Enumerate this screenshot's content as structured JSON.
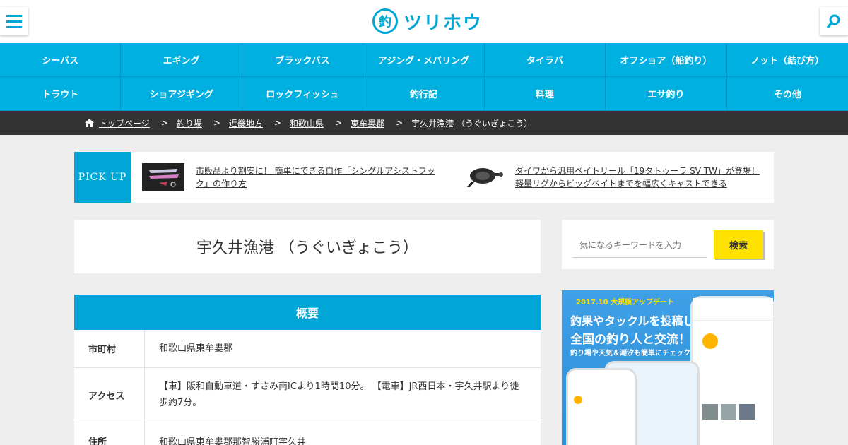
{
  "header": {
    "logo_mark": "釣",
    "logo_text": "ツリホウ"
  },
  "nav": {
    "items": [
      "シーバス",
      "エギング",
      "ブラックバス",
      "アジング・メバリング",
      "タイラバ",
      "オフショア（船釣り）",
      "ノット（結び方）",
      "トラウト",
      "ショアジギング",
      "ロックフィッシュ",
      "釣行記",
      "料理",
      "エサ釣り",
      "その他"
    ]
  },
  "breadcrumb": {
    "items": [
      "トップページ",
      "釣り場",
      "近畿地方",
      "和歌山県",
      "東牟婁郡"
    ],
    "current": "宇久井漁港 （うぐいぎょこう）",
    "separator": ">"
  },
  "pickup": {
    "label": "PICK UP",
    "items": [
      {
        "text": "市販品より割安に！ 簡単にできる自作「シングルアシストフック」の作り方"
      },
      {
        "text": "ダイワから汎用ベイトリール「19タトゥーラ SV TW」が登場！軽量リグからビッグベイトまでを幅広くキャストできる"
      }
    ]
  },
  "page": {
    "title": "宇久井漁港 （うぐいぎょこう）"
  },
  "overview": {
    "heading": "概要",
    "rows": [
      {
        "label": "市町村",
        "value": "和歌山県東牟婁郡"
      },
      {
        "label": "アクセス",
        "value": "【車】阪和自動車道・すさみ南ICより1時間10分。 【電車】JR西日本・宇久井駅より徒歩約7分。"
      },
      {
        "label": "住所",
        "value": "和歌山県東牟婁郡那智勝浦町宇久井"
      }
    ]
  },
  "sidebar": {
    "search_placeholder": "気になるキーワードを入力",
    "search_button": "検索",
    "banner": {
      "tag": "2017.10 大規模アップデート",
      "line1": "釣果やタックルを投稿して",
      "line2": "全国の釣り人と交流！",
      "line3": "釣り場や天気＆潮汐も簡単にチェック"
    }
  },
  "colors": {
    "accent": "#00a7d6",
    "nav": "#00b0e0",
    "breadcrumb_bg": "#333333",
    "search_button": "#ffe100"
  }
}
